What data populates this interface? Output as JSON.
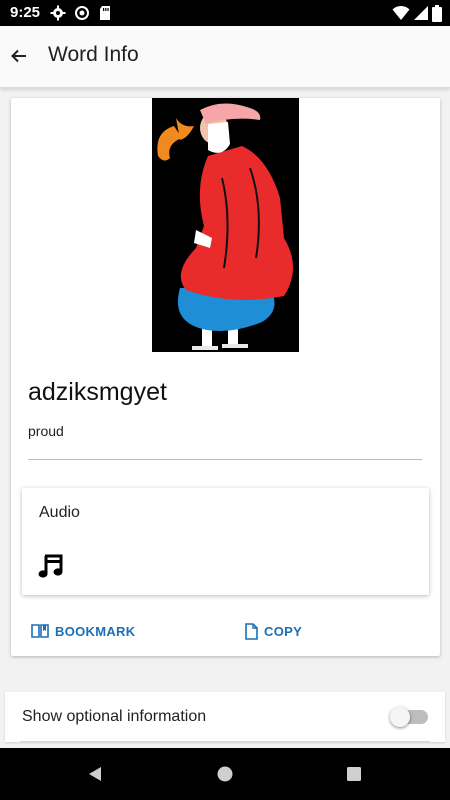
{
  "status_bar": {
    "time": "9:25"
  },
  "app_bar": {
    "title": "Word Info"
  },
  "word_card": {
    "word": "adziksmgyet",
    "translation": "proud",
    "audio": {
      "label": "Audio"
    },
    "actions": {
      "bookmark_label": "BOOKMARK",
      "copy_label": "COPY"
    }
  },
  "optional_info": {
    "label": "Show optional information",
    "enabled": false
  },
  "colors": {
    "accent": "#1a6fb5",
    "status_bar": "#000000",
    "card": "#ffffff",
    "background": "#f2f2f2"
  }
}
